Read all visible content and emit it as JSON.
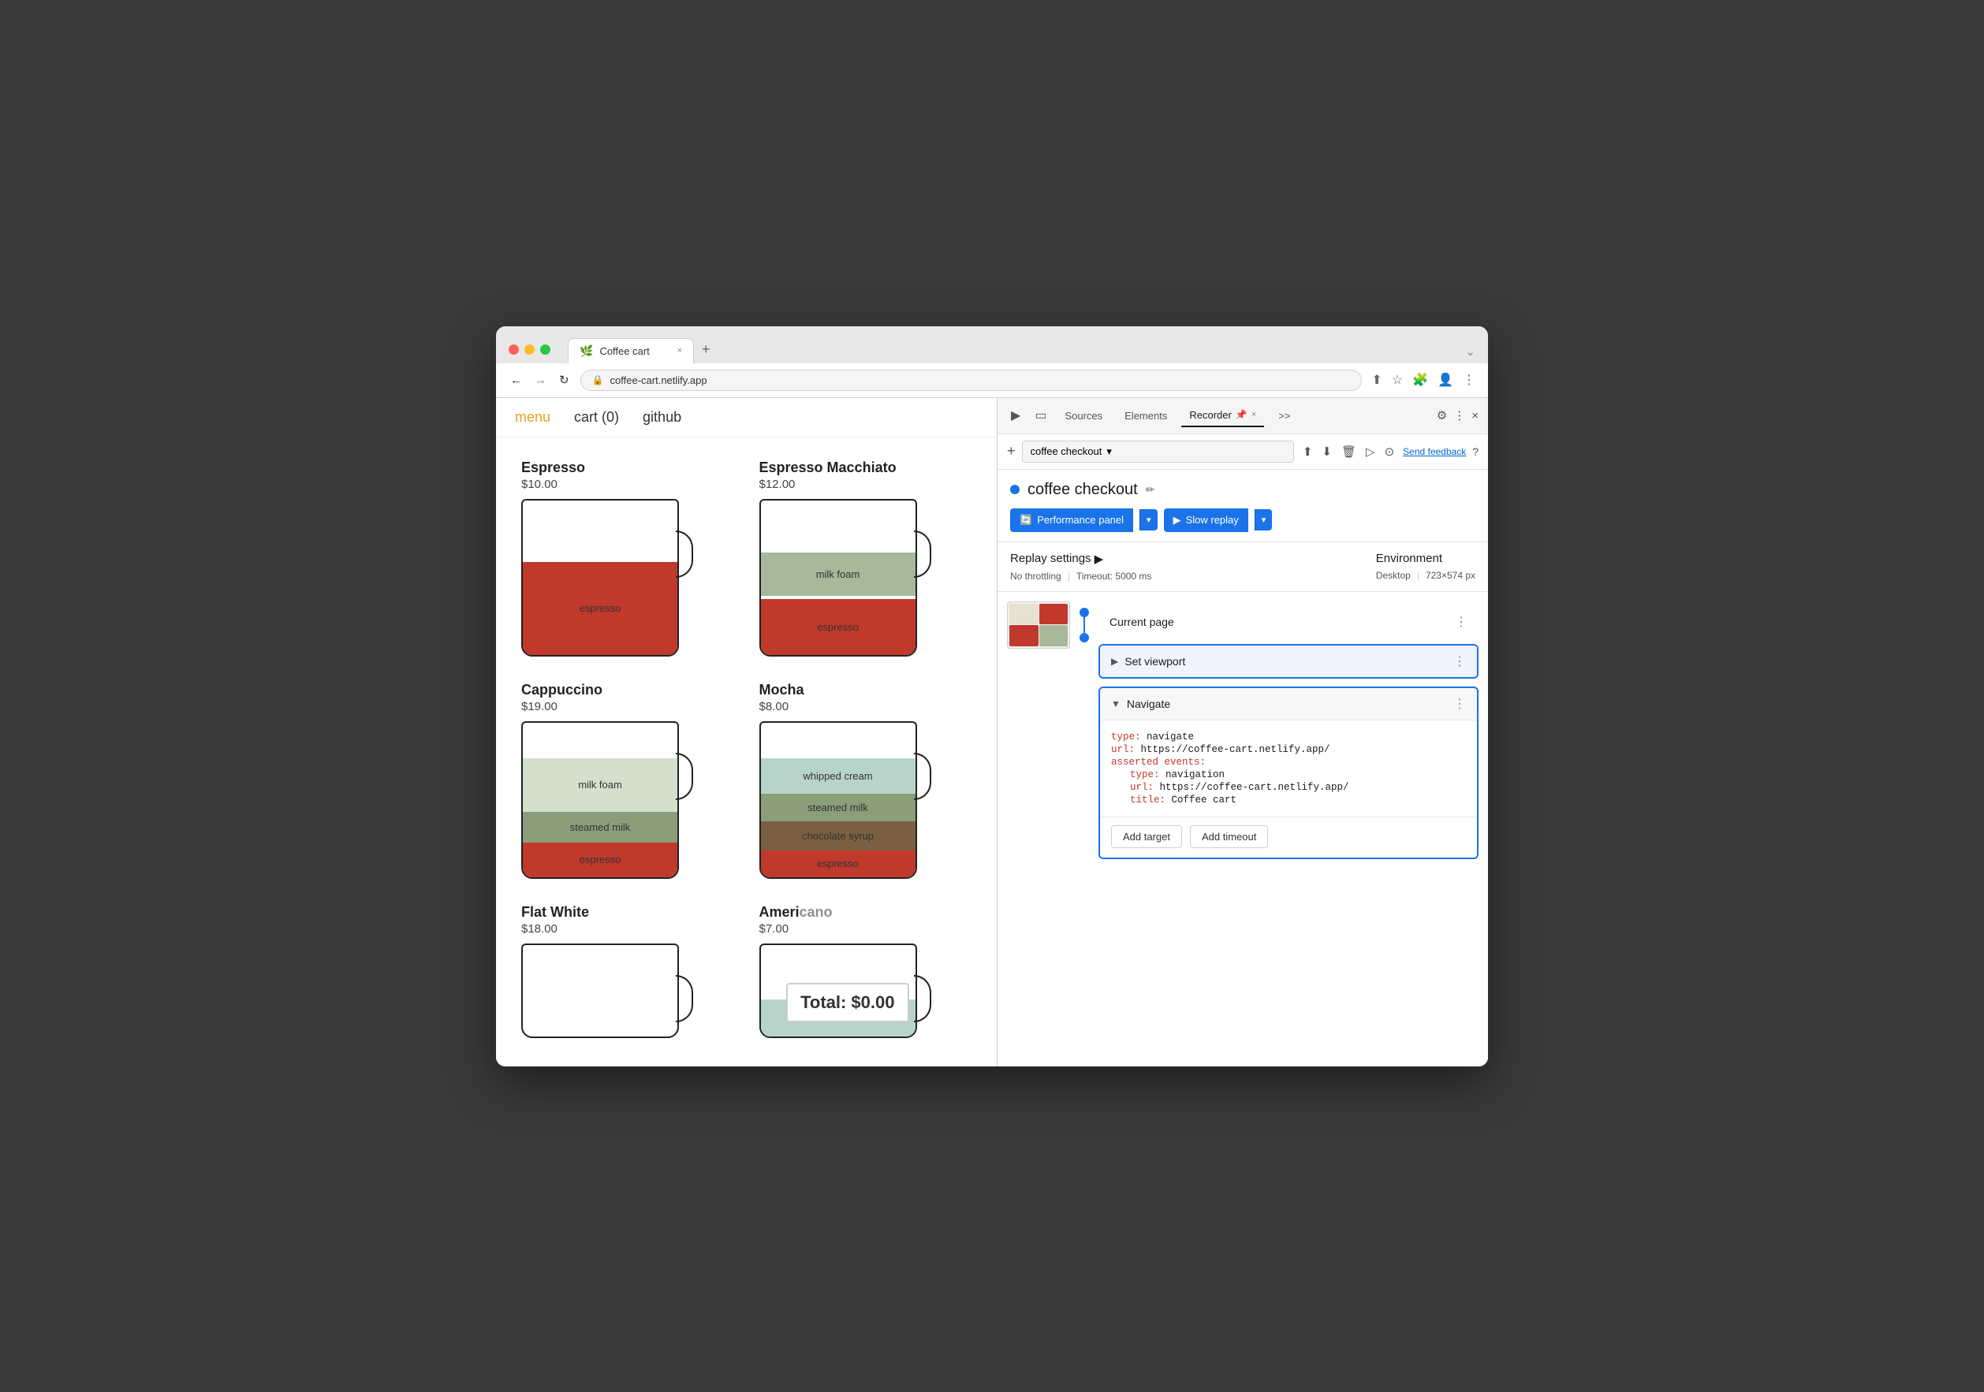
{
  "browser": {
    "tab_title": "Coffee cart",
    "url": "coffee-cart.netlify.app",
    "new_tab_label": "+",
    "close_tab_label": "×"
  },
  "devtools": {
    "tabs": [
      "Sources",
      "Elements",
      "Recorder",
      ">>"
    ],
    "recorder_tab": "Recorder",
    "pin_label": "📌",
    "close_label": "×",
    "more_label": "⋮"
  },
  "recorder_bar": {
    "add_label": "+",
    "recording_name": "coffee checkout",
    "dropdown_arrow": "▾",
    "send_feedback_label": "Send feedback",
    "help_label": "?"
  },
  "recording": {
    "title": "coffee checkout",
    "edit_icon": "✏",
    "dot_color": "#1a73e8",
    "perf_btn_label": "Performance panel",
    "perf_arrow": "▾",
    "slow_replay_label": "Slow replay",
    "slow_replay_icon": "▶",
    "slow_replay_arrow": "▾"
  },
  "replay_settings": {
    "title": "Replay settings",
    "arrow": "▶",
    "no_throttling": "No throttling",
    "timeout": "Timeout: 5000 ms",
    "separator": "|",
    "env_title": "Environment",
    "desktop": "Desktop",
    "resolution": "723×574 px"
  },
  "current_page": {
    "title": "Current page",
    "more": "⋮"
  },
  "steps": {
    "set_viewport": {
      "title": "Set viewport",
      "expand": "▶",
      "more": "⋮"
    },
    "navigate": {
      "title": "Navigate",
      "expand": "▼",
      "more": "⋮",
      "code": {
        "type_key": "type:",
        "type_val": " navigate",
        "url_key": "url:",
        "url_val": " https://coffee-cart.netlify.app/",
        "asserted_key": "asserted events:",
        "nav_type_key": "type:",
        "nav_type_val": " navigation",
        "nav_url_key": "url:",
        "nav_url_val": " https://coffee-cart.netlify.app/",
        "title_key": "title:",
        "title_val": " Coffee cart"
      },
      "add_target_label": "Add target",
      "add_timeout_label": "Add timeout"
    }
  },
  "site": {
    "nav": {
      "menu": "menu",
      "cart": "cart (0)",
      "github": "github"
    },
    "coffees": [
      {
        "name": "Espresso",
        "price": "$10.00",
        "layers": [
          {
            "label": "espresso",
            "color": "#c0392b",
            "height": "60%",
            "bottom": "0"
          }
        ]
      },
      {
        "name": "Espresso Macchiato",
        "price": "$12.00",
        "layers": [
          {
            "label": "milk foam",
            "color": "#a8b89a",
            "height": "28%",
            "bottom": "37%"
          },
          {
            "label": "espresso",
            "color": "#c0392b",
            "height": "35%",
            "bottom": "0"
          }
        ]
      },
      {
        "name": "Cappuccino",
        "price": "$19.00",
        "layers": [
          {
            "label": "milk foam",
            "color": "#d4e0cc",
            "height": "35%",
            "bottom": "40%"
          },
          {
            "label": "steamed milk",
            "color": "#8a9e7a",
            "height": "20%",
            "bottom": "22%"
          },
          {
            "label": "espresso",
            "color": "#c0392b",
            "height": "22%",
            "bottom": "0"
          }
        ]
      },
      {
        "name": "Mocha",
        "price": "$8.00",
        "layers": [
          {
            "label": "whipped cream",
            "color": "#b8d4c8",
            "height": "25%",
            "bottom": "52%"
          },
          {
            "label": "steamed milk",
            "color": "#8a9e7a",
            "height": "20%",
            "bottom": "34%"
          },
          {
            "label": "chocolate syrup",
            "color": "#7a6040",
            "height": "20%",
            "bottom": "16%"
          },
          {
            "label": "espresso",
            "color": "#c0392b",
            "height": "16%",
            "bottom": "0"
          }
        ]
      },
      {
        "name": "Flat White",
        "price": "$18.00"
      },
      {
        "name": "Americano",
        "price": "$7.00"
      }
    ],
    "total_label": "Total: $0.00"
  }
}
